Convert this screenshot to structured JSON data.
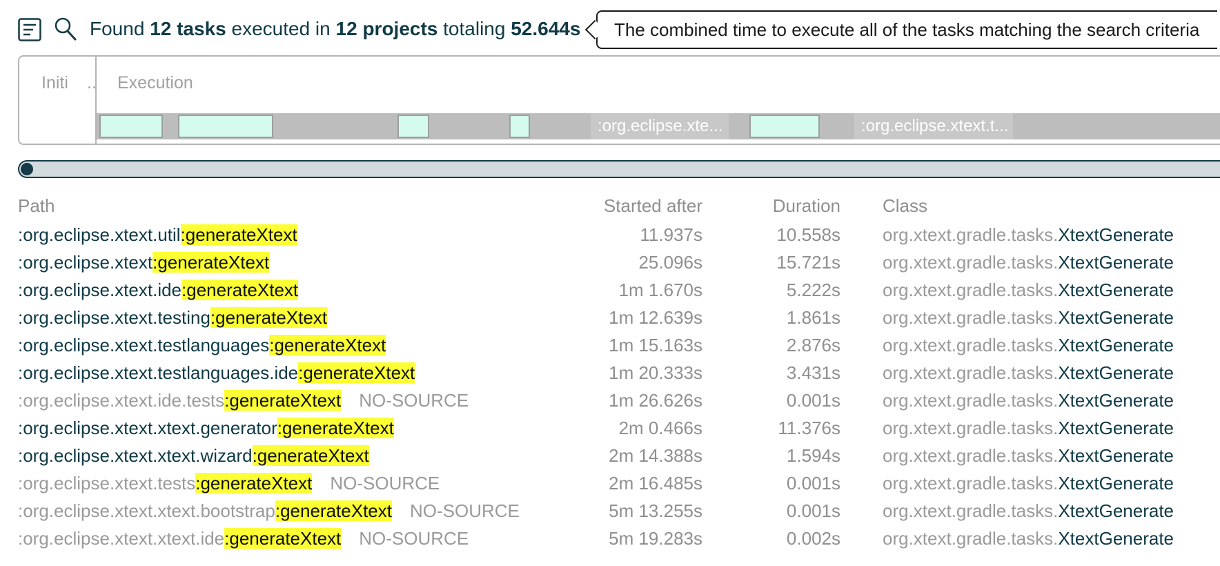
{
  "icons": {
    "panel": "list-panel-icon",
    "search": "search-icon"
  },
  "summary": {
    "found": "Found",
    "task_count": "12 tasks",
    "executed_in": "executed in",
    "project_count": "12 projects",
    "totaling": "totaling",
    "total_time": "52.644s"
  },
  "tooltip": {
    "text": "The combined time to execute all of the tasks matching the search criteria"
  },
  "timeline": {
    "init_label": "Initi",
    "init_ellipsis": "..",
    "exec_label": "Execution",
    "seg_label_1": ":org.eclipse.xte...",
    "seg_label_2": ":org.eclipse.xtext.t..."
  },
  "table": {
    "headers": {
      "path": "Path",
      "started_after": "Started after",
      "duration": "Duration",
      "class": "Class"
    },
    "rows": [
      {
        "project": ":org.eclipse.xtext.util",
        "task": ":generateXtext",
        "outcome": "",
        "started": "11.937s",
        "duration": "10.558s",
        "pkg": "org.xtext.gradle.tasks.",
        "cls": "XtextGenerate"
      },
      {
        "project": ":org.eclipse.xtext",
        "task": ":generateXtext",
        "outcome": "",
        "started": "25.096s",
        "duration": "15.721s",
        "pkg": "org.xtext.gradle.tasks.",
        "cls": "XtextGenerate"
      },
      {
        "project": ":org.eclipse.xtext.ide",
        "task": ":generateXtext",
        "outcome": "",
        "started": "1m 1.670s",
        "duration": "5.222s",
        "pkg": "org.xtext.gradle.tasks.",
        "cls": "XtextGenerate"
      },
      {
        "project": ":org.eclipse.xtext.testing",
        "task": ":generateXtext",
        "outcome": "",
        "started": "1m 12.639s",
        "duration": "1.861s",
        "pkg": "org.xtext.gradle.tasks.",
        "cls": "XtextGenerate"
      },
      {
        "project": ":org.eclipse.xtext.testlanguages",
        "task": ":generateXtext",
        "outcome": "",
        "started": "1m 15.163s",
        "duration": "2.876s",
        "pkg": "org.xtext.gradle.tasks.",
        "cls": "XtextGenerate"
      },
      {
        "project": ":org.eclipse.xtext.testlanguages.ide",
        "task": ":generateXtext",
        "outcome": "",
        "started": "1m 20.333s",
        "duration": "3.431s",
        "pkg": "org.xtext.gradle.tasks.",
        "cls": "XtextGenerate"
      },
      {
        "project": ":org.eclipse.xtext.ide.tests",
        "task": ":generateXtext",
        "outcome": "NO-SOURCE",
        "started": "1m 26.626s",
        "duration": "0.001s",
        "pkg": "org.xtext.gradle.tasks.",
        "cls": "XtextGenerate"
      },
      {
        "project": ":org.eclipse.xtext.xtext.generator",
        "task": ":generateXtext",
        "outcome": "",
        "started": "2m 0.466s",
        "duration": "11.376s",
        "pkg": "org.xtext.gradle.tasks.",
        "cls": "XtextGenerate"
      },
      {
        "project": ":org.eclipse.xtext.xtext.wizard",
        "task": ":generateXtext",
        "outcome": "",
        "started": "2m 14.388s",
        "duration": "1.594s",
        "pkg": "org.xtext.gradle.tasks.",
        "cls": "XtextGenerate"
      },
      {
        "project": ":org.eclipse.xtext.tests",
        "task": ":generateXtext",
        "outcome": "NO-SOURCE",
        "started": "2m 16.485s",
        "duration": "0.001s",
        "pkg": "org.xtext.gradle.tasks.",
        "cls": "XtextGenerate"
      },
      {
        "project": ":org.eclipse.xtext.xtext.bootstrap",
        "task": ":generateXtext",
        "outcome": "NO-SOURCE",
        "started": "5m 13.255s",
        "duration": "0.001s",
        "pkg": "org.xtext.gradle.tasks.",
        "cls": "XtextGenerate"
      },
      {
        "project": ":org.eclipse.xtext.xtext.ide",
        "task": ":generateXtext",
        "outcome": "NO-SOURCE",
        "started": "5m 19.283s",
        "duration": "0.002s",
        "pkg": "org.xtext.gradle.tasks.",
        "cls": "XtextGenerate"
      }
    ]
  },
  "colors": {
    "highlight": "#fbff33",
    "segment_fill": "#d4fbed",
    "accent": "#143b47"
  }
}
